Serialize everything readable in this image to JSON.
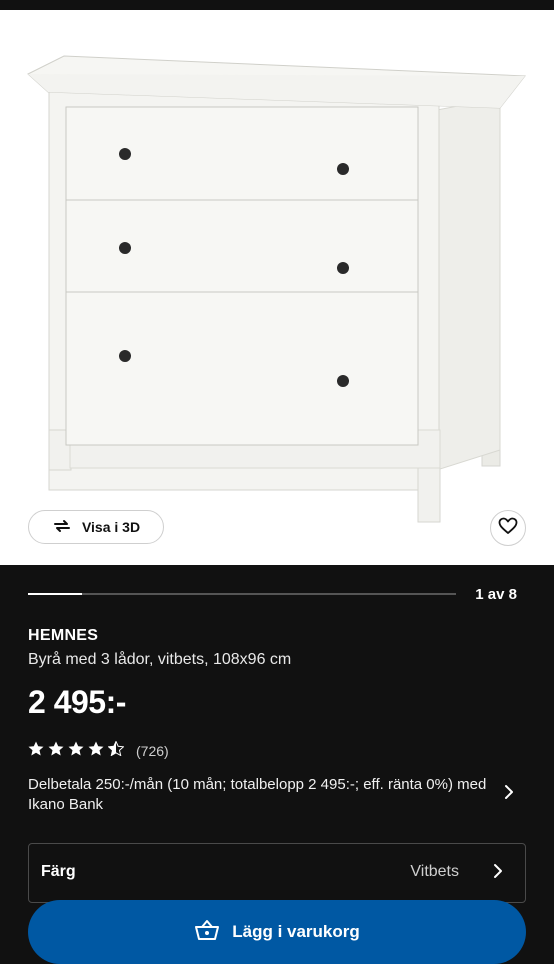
{
  "gallery": {
    "view3d_label": "Visa i 3D",
    "pager_text": "1 av 8",
    "progress_fraction": 0.125
  },
  "product": {
    "brand": "HEMNES",
    "description": "Byrå med 3 lådor, vitbets, 108x96 cm",
    "price": "2 495:-",
    "rating_value": 4.5,
    "rating_count": "(726)"
  },
  "installment": {
    "text": "Delbetala 250:-/mån (10 mån; totalbelopp 2 495:-; eff. ränta 0%) med Ikano Bank"
  },
  "color_option": {
    "label": "Färg",
    "value": "Vitbets"
  },
  "cart": {
    "button_label": "Lägg i varukorg"
  },
  "colors": {
    "page_bg": "#111111",
    "accent": "#0058a3",
    "text": "#ffffff"
  }
}
